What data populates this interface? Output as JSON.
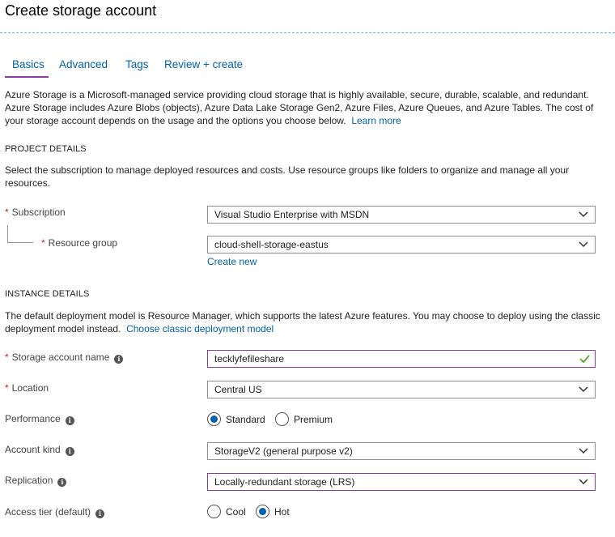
{
  "page": {
    "title": "Create storage account"
  },
  "tabs": [
    {
      "label": "Basics",
      "active": true
    },
    {
      "label": "Advanced",
      "active": false
    },
    {
      "label": "Tags",
      "active": false
    },
    {
      "label": "Review + create",
      "active": false
    }
  ],
  "intro": {
    "line1": "Azure Storage is a Microsoft-managed service providing cloud storage that is highly available, secure, durable, scalable, and redundant.",
    "line2": "Azure Storage includes Azure Blobs (objects), Azure Data Lake Storage Gen2, Azure Files, Azure Queues, and Azure Tables. The cost of",
    "line3": "your storage account depends on the usage and the options you choose below.",
    "learn_more": "Learn more"
  },
  "project": {
    "heading": "PROJECT DETAILS",
    "desc_line1": "Select the subscription to manage deployed resources and costs. Use resource groups like folders to organize and manage all your",
    "desc_line2": "resources.",
    "subscription_label": "Subscription",
    "subscription_value": "Visual Studio Enterprise with MSDN",
    "resource_group_label": "Resource group",
    "resource_group_value": "cloud-shell-storage-eastus",
    "create_new": "Create new",
    "required_mark": "*"
  },
  "instance": {
    "heading": "INSTANCE DETAILS",
    "desc_line1": "The default deployment model is Resource Manager, which supports the latest Azure features. You may choose to deploy using the classic",
    "desc_line2": "deployment model instead.",
    "classic_link": "Choose classic deployment model",
    "name_label": "Storage account name",
    "name_value": "tecklyfefileshare",
    "location_label": "Location",
    "location_value": "Central US",
    "performance_label": "Performance",
    "performance_options": [
      {
        "label": "Standard",
        "selected": true
      },
      {
        "label": "Premium",
        "selected": false
      }
    ],
    "kind_label": "Account kind",
    "kind_value": "StorageV2 (general purpose v2)",
    "replication_label": "Replication",
    "replication_value": "Locally-redundant storage (LRS)",
    "access_label": "Access tier (default)",
    "access_options": [
      {
        "label": "Cool",
        "selected": false
      },
      {
        "label": "Hot",
        "selected": true
      }
    ],
    "info_glyph": "i"
  },
  "colors": {
    "accent": "#0062ad",
    "tab_underline": "#8a3c9c",
    "required": "#c0202b",
    "valid_check": "#5ba52a"
  },
  "icons": {
    "dropdown": "chevron-down-icon",
    "info": "info-icon",
    "valid": "checkmark-icon"
  }
}
